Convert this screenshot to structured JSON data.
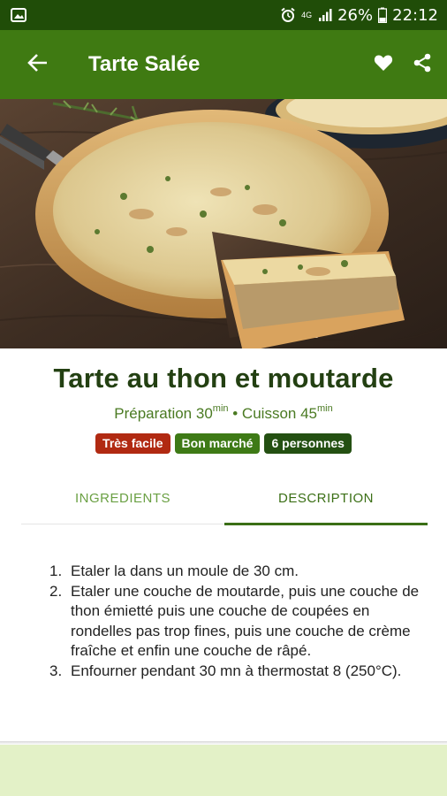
{
  "statusbar": {
    "network": "4G",
    "battery": "26%",
    "time": "22:12"
  },
  "appbar": {
    "title": "Tarte Salée"
  },
  "recipe": {
    "title": "Tarte au thon et moutarde",
    "prep_label": "Préparation ",
    "prep_value": "30",
    "cook_label": " • Cuisson ",
    "cook_value": "45",
    "unit": "min",
    "badges": [
      {
        "label": "Très facile",
        "color": "#b12a12"
      },
      {
        "label": "Bon marché",
        "color": "#3e7a16"
      },
      {
        "label": "6 personnes",
        "color": "#245012"
      }
    ]
  },
  "tabs": [
    {
      "label": "INGREDIENTS",
      "active": false
    },
    {
      "label": "DESCRIPTION",
      "active": true
    }
  ],
  "steps": [
    {
      "num": "1.",
      "text": "Etaler la dans un moule de 30 cm."
    },
    {
      "num": "2.",
      "text": "Etaler une couche de moutarde, puis une couche de thon émietté puis une couche de coupées en rondelles pas trop fines, puis une couche de crème fraîche et enfin une couche de râpé."
    },
    {
      "num": "3.",
      "text": "Enfourner pendant 30 mn à thermostat 8 (250°C)."
    }
  ],
  "colors": {
    "status_bar": "#204d08",
    "app_bar": "#3f7a12",
    "accent": "#3b6f16",
    "bottom_band": "#e3f1c7"
  },
  "icons": {
    "status_left": "image-icon",
    "alarm": "alarm-icon",
    "signal": "signal-icon",
    "battery": "battery-icon",
    "back": "arrow-back-icon",
    "favorite": "heart-icon",
    "share": "share-icon"
  }
}
